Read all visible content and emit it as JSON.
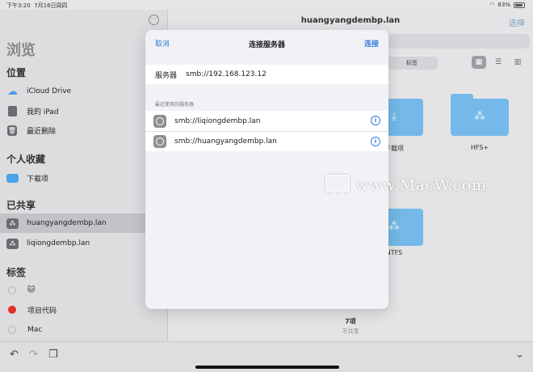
{
  "status": {
    "time": "下午3:20",
    "date": "7月16日周四",
    "battery": "63%",
    "wifi_icon": "wifi-icon"
  },
  "sidebar": {
    "browse_title": "浏览",
    "locations_title": "位置",
    "locations": [
      {
        "label": "iCloud Drive",
        "icon": "cloud-icon"
      },
      {
        "label": "我的 iPad",
        "icon": "ipad-icon"
      },
      {
        "label": "最近删除",
        "icon": "trash-icon"
      }
    ],
    "favorites_title": "个人收藏",
    "favorites": [
      {
        "label": "下载项",
        "icon": "folder-icon"
      }
    ],
    "shared_title": "已共享",
    "shared": [
      {
        "label": "huangyangdembp.lan",
        "selected": true
      },
      {
        "label": "liqiongdembp.lan",
        "selected": false
      }
    ],
    "tags_title": "标签",
    "tags": [
      {
        "label": "🐱",
        "color": ""
      },
      {
        "label": "项目代码",
        "color": "#e0312d"
      },
      {
        "label": "Mac",
        "color": ""
      }
    ]
  },
  "main": {
    "title": "huangyangdembp.lan",
    "select_label": "选择",
    "segment_label": "标签",
    "folders": [
      {
        "label": "下载项"
      },
      {
        "label": "HFS+"
      },
      {
        "label": "NTFS"
      }
    ],
    "count": "7项",
    "count_sub": "不共享"
  },
  "modal": {
    "cancel_label": "取消",
    "title": "连接服务器",
    "connect_label": "连接",
    "server_label": "服务器",
    "server_value": "smb://192.168.123.12",
    "recent_label": "最近使用的服务器",
    "recent_servers": [
      {
        "address": "smb://liqiongdembp.lan"
      },
      {
        "address": "smb://huangyangdembp.lan"
      }
    ],
    "accent_color": "#2f7fdc"
  },
  "watermark": {
    "text": "www.MacW.com"
  }
}
